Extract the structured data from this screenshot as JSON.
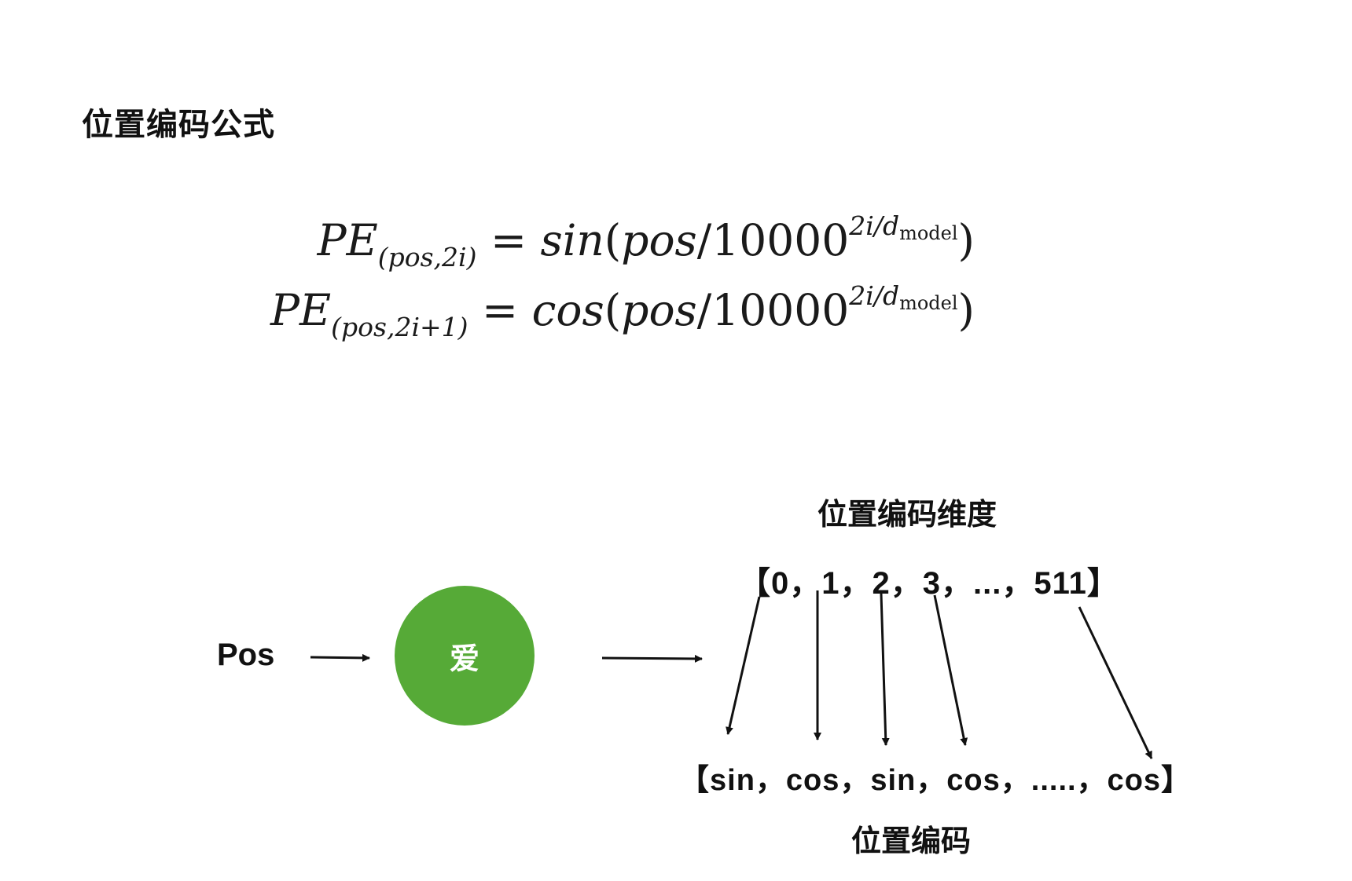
{
  "heading": "位置编码公式",
  "formula": {
    "line1": {
      "lhs": "PE",
      "lhs_sub": "(pos,2i)",
      "eq": "=",
      "func": "sin",
      "open": "(",
      "arg": "pos",
      "slash": "/",
      "base": "10000",
      "exp": "2i/d",
      "exp_sub": "model",
      "close": ")"
    },
    "line2": {
      "lhs": "PE",
      "lhs_sub": "(pos,2i+1)",
      "eq": "=",
      "func": "cos",
      "open": "(",
      "arg": "pos",
      "slash": "/",
      "base": "10000",
      "exp": "2i/d",
      "exp_sub": "model",
      "close": ")"
    }
  },
  "diagram": {
    "input_label": "Pos",
    "token": "爱",
    "token_color": "#56aa37",
    "dimension_title": "位置编码维度",
    "dimension_indices": "【0，1，2，3，...，511】",
    "encoding_values": "【sin，cos，sin，cos，.....，cos】",
    "encoding_title": "位置编码"
  }
}
